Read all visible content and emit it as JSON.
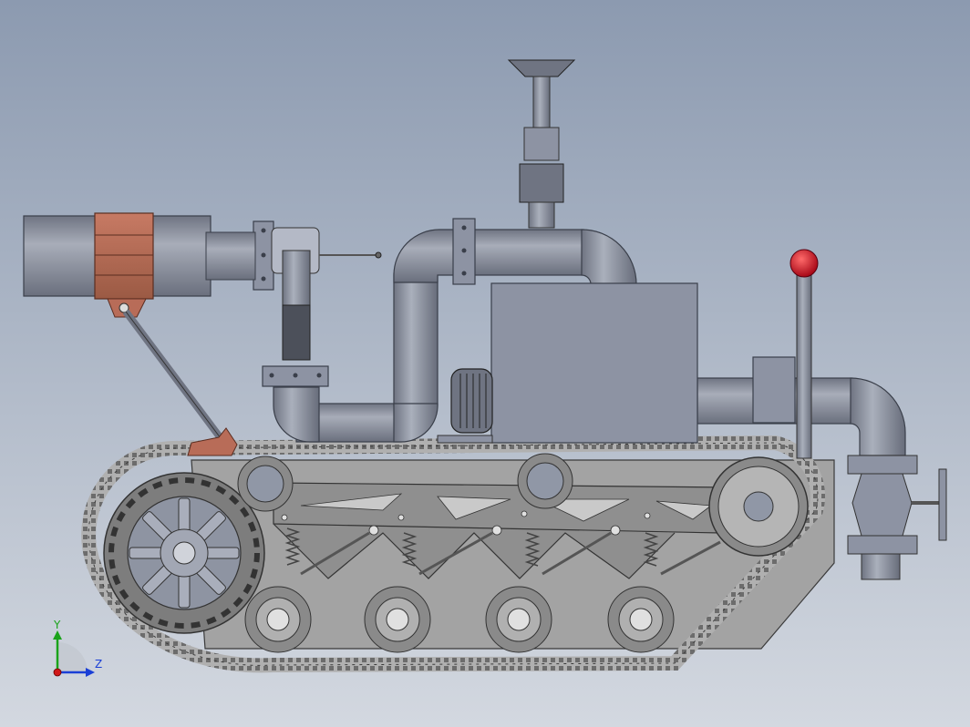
{
  "viewport": {
    "background_top": "#8c9ab0",
    "background_bottom": "#d3d8e0"
  },
  "model": {
    "colors": {
      "steel": "#8d93a3",
      "steel_dark": "#5f6472",
      "steel_light": "#b4b9c6",
      "track": "#a6a6a6",
      "frame": "#9a9a9a",
      "rust": "#b86c58",
      "knob_red": "#c8102e"
    }
  },
  "triad": {
    "y_label": "Y",
    "z_label": "Z",
    "y_color": "#1aa31a",
    "z_color": "#1a3fd6",
    "origin_color": "#d01818"
  }
}
